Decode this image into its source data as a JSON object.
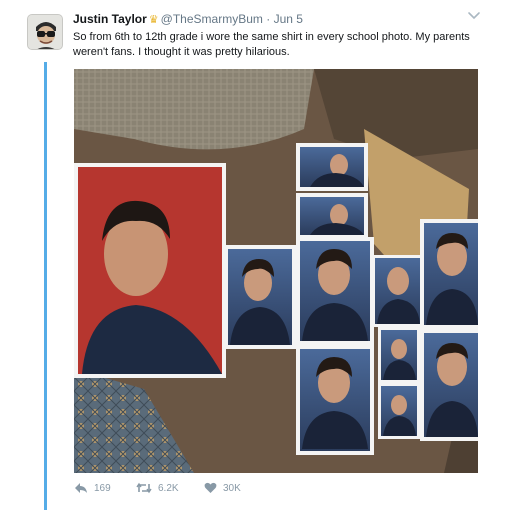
{
  "tweet": {
    "author_name": "Justin Taylor",
    "handle": "@TheSmarmyBum",
    "separator": "·",
    "date": "Jun 5",
    "text": "So from 6th to 12th grade i wore the same shirt in every school photo. My parents weren't fans. I thought it was pretty hilarious.",
    "badge_icon": "crown-icon",
    "menu_icon": "chevron-down-icon"
  },
  "actions": {
    "reply": {
      "icon": "reply-icon",
      "count": "169"
    },
    "retweet": {
      "icon": "retweet-icon",
      "count": "6.2K"
    },
    "like": {
      "icon": "heart-icon",
      "count": "30K"
    }
  },
  "colors": {
    "thread_line": "#55ace7",
    "action_gray": "#8899a6",
    "handle_gray": "#657786",
    "badge_gold": "#e8b42a"
  }
}
